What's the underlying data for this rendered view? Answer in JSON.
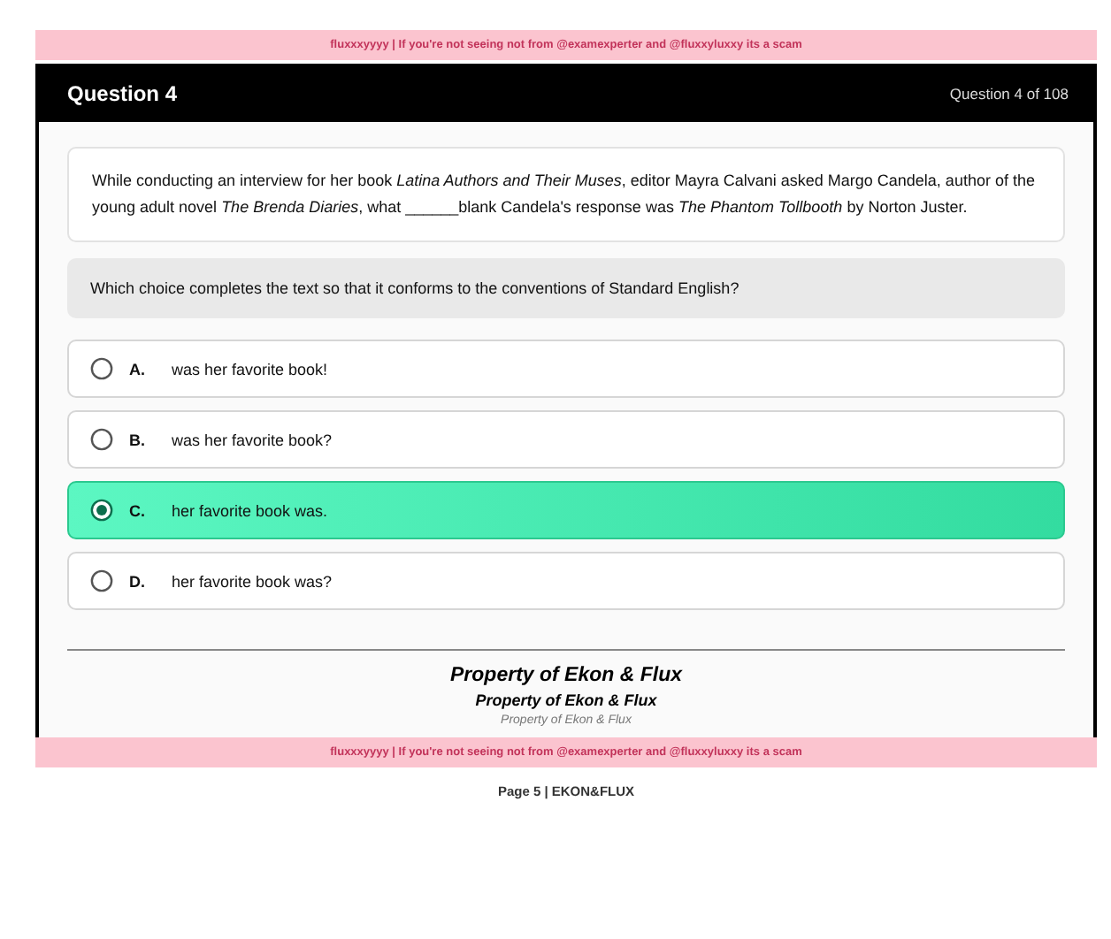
{
  "top_banner": "fluxxxyyyy | If you're not seeing not from @examexperter and @fluxxyluxxy its a scam",
  "header": {
    "title": "Question 4",
    "counter": "Question 4 of 108"
  },
  "passage": "While conducting an interview for her book *Latina Authors and Their Muses*, editor Mayra Calvani asked Margo Candela, author of the young adult novel *The Brenda Diaries*, what ______blank Candela's response was *The Phantom Tollbooth* by Norton Juster.",
  "prompt": "Which choice completes the text so that it conforms to the conventions of Standard English?",
  "choices": [
    {
      "letter": "A.",
      "text": "was her favorite book!",
      "selected": false
    },
    {
      "letter": "B.",
      "text": "was her favorite book?",
      "selected": false
    },
    {
      "letter": "C.",
      "text": "her favorite book was.",
      "selected": true
    },
    {
      "letter": "D.",
      "text": "her favorite book was?",
      "selected": false
    }
  ],
  "property_lines": [
    "Property of Ekon & Flux",
    "Property of Ekon & Flux",
    "Property of Ekon & Flux"
  ],
  "bottom_banner": "fluxxxyyyy | If you're not seeing not from @examexperter and @fluxxyluxxy its a scam",
  "page_footer": "Page 5 | EKON&FLUX"
}
